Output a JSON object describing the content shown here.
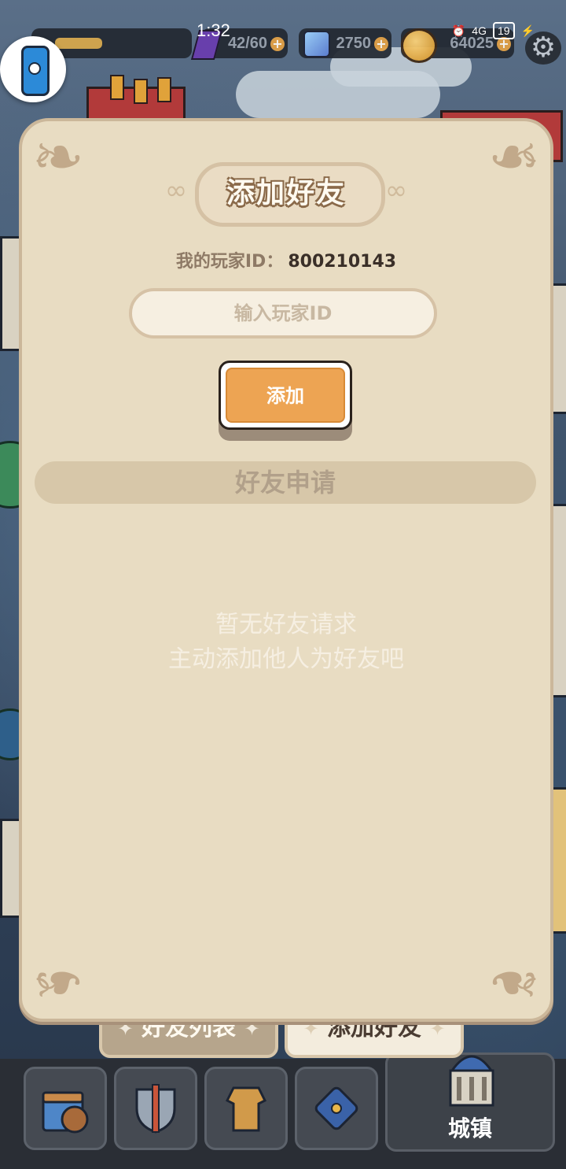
{
  "status_bar": {
    "time": "1:32",
    "network": "4G",
    "battery": "19"
  },
  "resources": {
    "stamina": "42/60",
    "gems": "2750",
    "coins": "64025",
    "plus_symbol": "+"
  },
  "dialog": {
    "title": "添加好友",
    "my_id_label": "我的玩家ID：",
    "my_id_value": "800210143",
    "id_input_placeholder": "输入玩家ID",
    "add_button_label": "添加",
    "requests_section_title": "好友申请",
    "empty_line1": "暂无好友请求",
    "empty_line2": "主动添加他人为好友吧"
  },
  "tabs": {
    "friend_list": "好友列表",
    "add_friend": "添加好友",
    "active": "add_friend"
  },
  "bottom_nav": {
    "items": [
      {
        "icon": "treasure-chest-icon"
      },
      {
        "icon": "sword-shield-icon"
      },
      {
        "icon": "armor-icon"
      },
      {
        "icon": "skill-dice-icon"
      }
    ],
    "town_label": "城镇"
  },
  "colors": {
    "panel_bg": "#e8dcc2",
    "accent_orange": "#eda453",
    "title_outline": "#8a6a4a"
  }
}
